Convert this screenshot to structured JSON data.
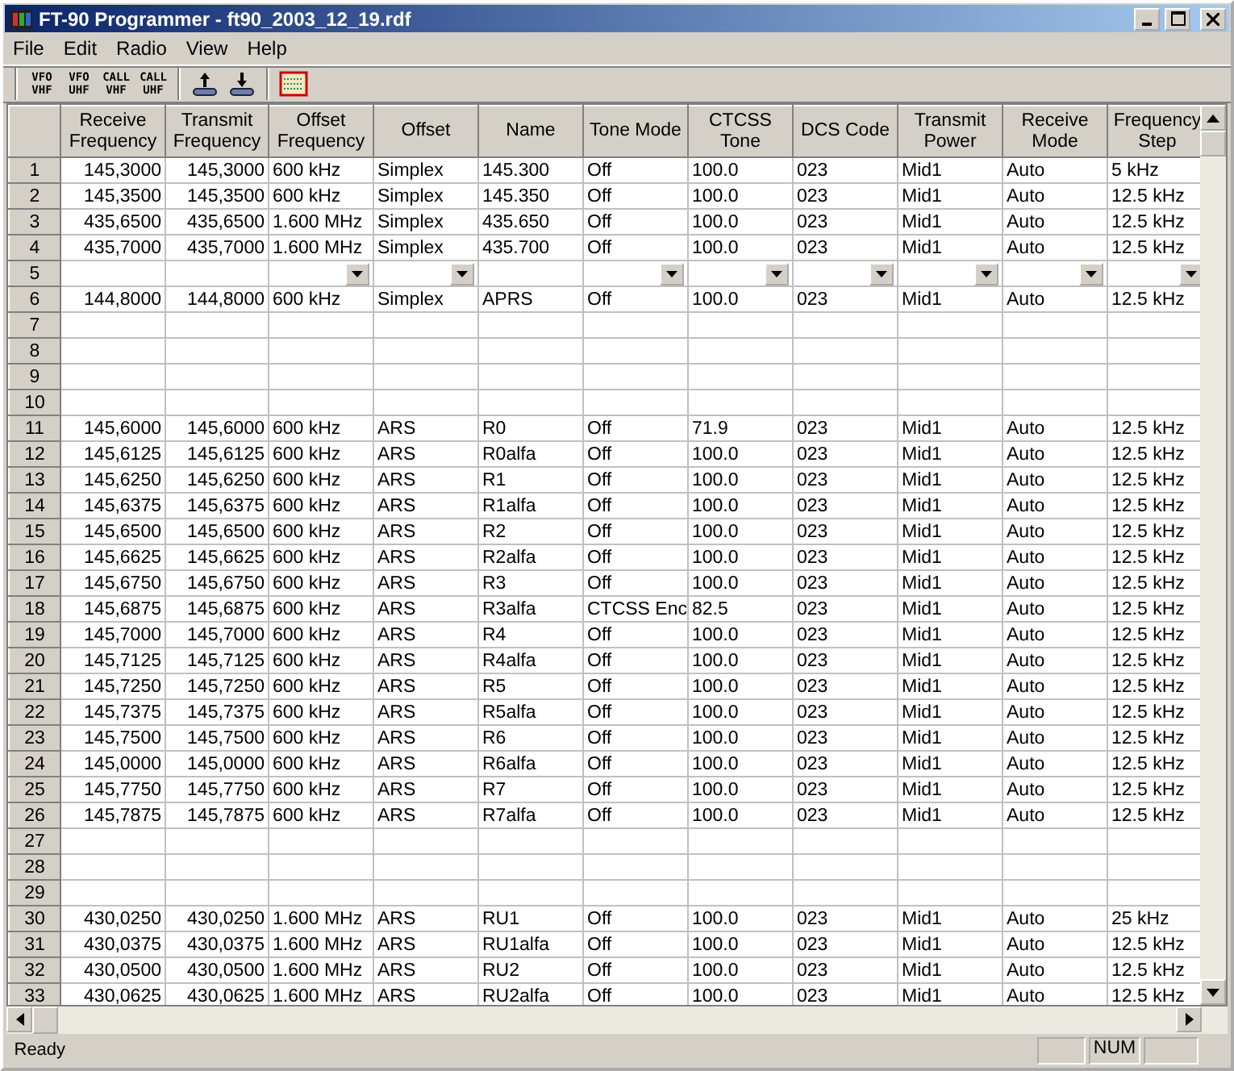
{
  "window": {
    "title": "FT-90 Programmer - ft90_2003_12_19.rdf"
  },
  "menu": [
    "File",
    "Edit",
    "Radio",
    "View",
    "Help"
  ],
  "toolbar": [
    {
      "kind": "text",
      "line1": "VFO",
      "line2": "VHF"
    },
    {
      "kind": "text",
      "line1": "VFO",
      "line2": "UHF"
    },
    {
      "kind": "text",
      "line1": "CALL",
      "line2": "VHF"
    },
    {
      "kind": "text",
      "line1": "CALL",
      "line2": "UHF"
    },
    {
      "kind": "upload"
    },
    {
      "kind": "download"
    },
    {
      "kind": "grid"
    }
  ],
  "table": {
    "columns": [
      {
        "label": "Receive Frequency",
        "kind": "number",
        "dropdown": false
      },
      {
        "label": "Transmit Frequency",
        "kind": "number",
        "dropdown": false
      },
      {
        "label": "Offset Frequency",
        "kind": "text",
        "dropdown": true
      },
      {
        "label": "Offset",
        "kind": "text",
        "dropdown": true
      },
      {
        "label": "Name",
        "kind": "text",
        "dropdown": false
      },
      {
        "label": "Tone Mode",
        "kind": "text",
        "dropdown": true
      },
      {
        "label": "CTCSS Tone",
        "kind": "text",
        "dropdown": true
      },
      {
        "label": "DCS Code",
        "kind": "text",
        "dropdown": true
      },
      {
        "label": "Transmit Power",
        "kind": "text",
        "dropdown": true
      },
      {
        "label": "Receive Mode",
        "kind": "text",
        "dropdown": true
      },
      {
        "label": "Frequency Step",
        "kind": "text",
        "dropdown": true
      }
    ],
    "rows": [
      {
        "number": "1",
        "kind": "data",
        "cells": [
          "145,3000",
          "145,3000",
          "600 kHz",
          "Simplex",
          "145.300",
          "Off",
          "100.0",
          "023",
          "Mid1",
          "Auto",
          "5 kHz"
        ]
      },
      {
        "number": "2",
        "kind": "data",
        "cells": [
          "145,3500",
          "145,3500",
          "600 kHz",
          "Simplex",
          "145.350",
          "Off",
          "100.0",
          "023",
          "Mid1",
          "Auto",
          "12.5 kHz"
        ]
      },
      {
        "number": "3",
        "kind": "data",
        "cells": [
          "435,6500",
          "435,6500",
          "1.600 MHz",
          "Simplex",
          "435.650",
          "Off",
          "100.0",
          "023",
          "Mid1",
          "Auto",
          "12.5 kHz"
        ]
      },
      {
        "number": "4",
        "kind": "data",
        "cells": [
          "435,7000",
          "435,7000",
          "1.600 MHz",
          "Simplex",
          "435.700",
          "Off",
          "100.0",
          "023",
          "Mid1",
          "Auto",
          "12.5 kHz"
        ]
      },
      {
        "number": "5",
        "kind": "dropdown"
      },
      {
        "number": "6",
        "kind": "data",
        "cells": [
          "144,8000",
          "144,8000",
          "600 kHz",
          "Simplex",
          "APRS",
          "Off",
          "100.0",
          "023",
          "Mid1",
          "Auto",
          "12.5 kHz"
        ]
      },
      {
        "number": "7",
        "kind": "empty"
      },
      {
        "number": "8",
        "kind": "empty"
      },
      {
        "number": "9",
        "kind": "empty"
      },
      {
        "number": "10",
        "kind": "empty"
      },
      {
        "number": "11",
        "kind": "data",
        "cells": [
          "145,6000",
          "145,6000",
          "600 kHz",
          "ARS",
          "R0",
          "Off",
          "71.9",
          "023",
          "Mid1",
          "Auto",
          "12.5 kHz"
        ]
      },
      {
        "number": "12",
        "kind": "data",
        "cells": [
          "145,6125",
          "145,6125",
          "600 kHz",
          "ARS",
          "R0alfa",
          "Off",
          "100.0",
          "023",
          "Mid1",
          "Auto",
          "12.5 kHz"
        ]
      },
      {
        "number": "13",
        "kind": "data",
        "cells": [
          "145,6250",
          "145,6250",
          "600 kHz",
          "ARS",
          "R1",
          "Off",
          "100.0",
          "023",
          "Mid1",
          "Auto",
          "12.5 kHz"
        ]
      },
      {
        "number": "14",
        "kind": "data",
        "cells": [
          "145,6375",
          "145,6375",
          "600 kHz",
          "ARS",
          "R1alfa",
          "Off",
          "100.0",
          "023",
          "Mid1",
          "Auto",
          "12.5 kHz"
        ]
      },
      {
        "number": "15",
        "kind": "data",
        "cells": [
          "145,6500",
          "145,6500",
          "600 kHz",
          "ARS",
          "R2",
          "Off",
          "100.0",
          "023",
          "Mid1",
          "Auto",
          "12.5 kHz"
        ]
      },
      {
        "number": "16",
        "kind": "data",
        "cells": [
          "145,6625",
          "145,6625",
          "600 kHz",
          "ARS",
          "R2alfa",
          "Off",
          "100.0",
          "023",
          "Mid1",
          "Auto",
          "12.5 kHz"
        ]
      },
      {
        "number": "17",
        "kind": "data",
        "cells": [
          "145,6750",
          "145,6750",
          "600 kHz",
          "ARS",
          "R3",
          "Off",
          "100.0",
          "023",
          "Mid1",
          "Auto",
          "12.5 kHz"
        ]
      },
      {
        "number": "18",
        "kind": "data",
        "cells": [
          "145,6875",
          "145,6875",
          "600 kHz",
          "ARS",
          "R3alfa",
          "CTCSS Enc",
          "82.5",
          "023",
          "Mid1",
          "Auto",
          "12.5 kHz"
        ]
      },
      {
        "number": "19",
        "kind": "data",
        "cells": [
          "145,7000",
          "145,7000",
          "600 kHz",
          "ARS",
          "R4",
          "Off",
          "100.0",
          "023",
          "Mid1",
          "Auto",
          "12.5 kHz"
        ]
      },
      {
        "number": "20",
        "kind": "data",
        "cells": [
          "145,7125",
          "145,7125",
          "600 kHz",
          "ARS",
          "R4alfa",
          "Off",
          "100.0",
          "023",
          "Mid1",
          "Auto",
          "12.5 kHz"
        ]
      },
      {
        "number": "21",
        "kind": "data",
        "cells": [
          "145,7250",
          "145,7250",
          "600 kHz",
          "ARS",
          "R5",
          "Off",
          "100.0",
          "023",
          "Mid1",
          "Auto",
          "12.5 kHz"
        ]
      },
      {
        "number": "22",
        "kind": "data",
        "cells": [
          "145,7375",
          "145,7375",
          "600 kHz",
          "ARS",
          "R5alfa",
          "Off",
          "100.0",
          "023",
          "Mid1",
          "Auto",
          "12.5 kHz"
        ]
      },
      {
        "number": "23",
        "kind": "data",
        "cells": [
          "145,7500",
          "145,7500",
          "600 kHz",
          "ARS",
          "R6",
          "Off",
          "100.0",
          "023",
          "Mid1",
          "Auto",
          "12.5 kHz"
        ]
      },
      {
        "number": "24",
        "kind": "data",
        "cells": [
          "145,0000",
          "145,0000",
          "600 kHz",
          "ARS",
          "R6alfa",
          "Off",
          "100.0",
          "023",
          "Mid1",
          "Auto",
          "12.5 kHz"
        ]
      },
      {
        "number": "25",
        "kind": "data",
        "cells": [
          "145,7750",
          "145,7750",
          "600 kHz",
          "ARS",
          "R7",
          "Off",
          "100.0",
          "023",
          "Mid1",
          "Auto",
          "12.5 kHz"
        ]
      },
      {
        "number": "26",
        "kind": "data",
        "cells": [
          "145,7875",
          "145,7875",
          "600 kHz",
          "ARS",
          "R7alfa",
          "Off",
          "100.0",
          "023",
          "Mid1",
          "Auto",
          "12.5 kHz"
        ]
      },
      {
        "number": "27",
        "kind": "empty"
      },
      {
        "number": "28",
        "kind": "empty"
      },
      {
        "number": "29",
        "kind": "empty"
      },
      {
        "number": "30",
        "kind": "data",
        "cells": [
          "430,0250",
          "430,0250",
          "1.600 MHz",
          "ARS",
          "RU1",
          "Off",
          "100.0",
          "023",
          "Mid1",
          "Auto",
          "25 kHz"
        ]
      },
      {
        "number": "31",
        "kind": "data",
        "cells": [
          "430,0375",
          "430,0375",
          "1.600 MHz",
          "ARS",
          "RU1alfa",
          "Off",
          "100.0",
          "023",
          "Mid1",
          "Auto",
          "12.5 kHz"
        ]
      },
      {
        "number": "32",
        "kind": "data",
        "cells": [
          "430,0500",
          "430,0500",
          "1.600 MHz",
          "ARS",
          "RU2",
          "Off",
          "100.0",
          "023",
          "Mid1",
          "Auto",
          "12.5 kHz"
        ]
      },
      {
        "number": "33",
        "kind": "data",
        "cells": [
          "430,0625",
          "430,0625",
          "1.600 MHz",
          "ARS",
          "RU2alfa",
          "Off",
          "100.0",
          "023",
          "Mid1",
          "Auto",
          "12.5 kHz"
        ]
      }
    ]
  },
  "status_bar": {
    "text": "Ready",
    "indicators": [
      "NUM"
    ]
  }
}
